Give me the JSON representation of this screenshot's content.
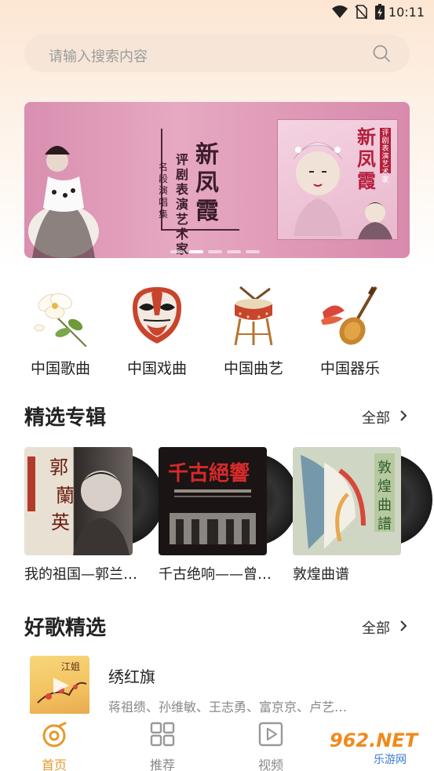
{
  "status_bar": {
    "time": "10:11",
    "icons": [
      "wifi-icon",
      "no-sim-icon",
      "battery-charging-icon"
    ]
  },
  "search": {
    "placeholder": "请输入搜索内容",
    "icon": "search-icon"
  },
  "banner": {
    "heading": "新凤霞",
    "subheading": "评剧表演艺术家",
    "caption": "名段演唱集",
    "album_title": "新凤霞",
    "album_tag": "评剧表演艺术家",
    "active_dot": 1,
    "dot_count": 5
  },
  "categories": [
    {
      "label": "中国歌曲",
      "icon": "magnolia-flower-icon"
    },
    {
      "label": "中国戏曲",
      "icon": "opera-mask-icon"
    },
    {
      "label": "中国曲艺",
      "icon": "drum-icon"
    },
    {
      "label": "中国器乐",
      "icon": "pipa-icon"
    }
  ],
  "featured_albums": {
    "title": "精选专辑",
    "more_label": "全部",
    "items": [
      {
        "title": "我的祖国—郭兰…"
      },
      {
        "title": "千古绝响——曾…"
      },
      {
        "title": "敦煌曲谱"
      }
    ]
  },
  "good_songs": {
    "title": "好歌精选",
    "more_label": "全部",
    "items": [
      {
        "title": "绣红旗",
        "artists": "蒋祖缋、孙维敏、王志勇、富京京、卢艺…"
      }
    ]
  },
  "bottom_nav": {
    "items": [
      {
        "label": "首页",
        "icon": "home-disc-icon",
        "active": true
      },
      {
        "label": "推荐",
        "icon": "grid-icon",
        "active": false
      },
      {
        "label": "视频",
        "icon": "video-play-icon",
        "active": false
      }
    ]
  },
  "watermark": {
    "big": "962.NET",
    "small": "乐游网"
  },
  "colors": {
    "accent": "#e39a2c",
    "banner_pink": "#d98fb0",
    "text": "#222222",
    "muted": "#888888"
  }
}
